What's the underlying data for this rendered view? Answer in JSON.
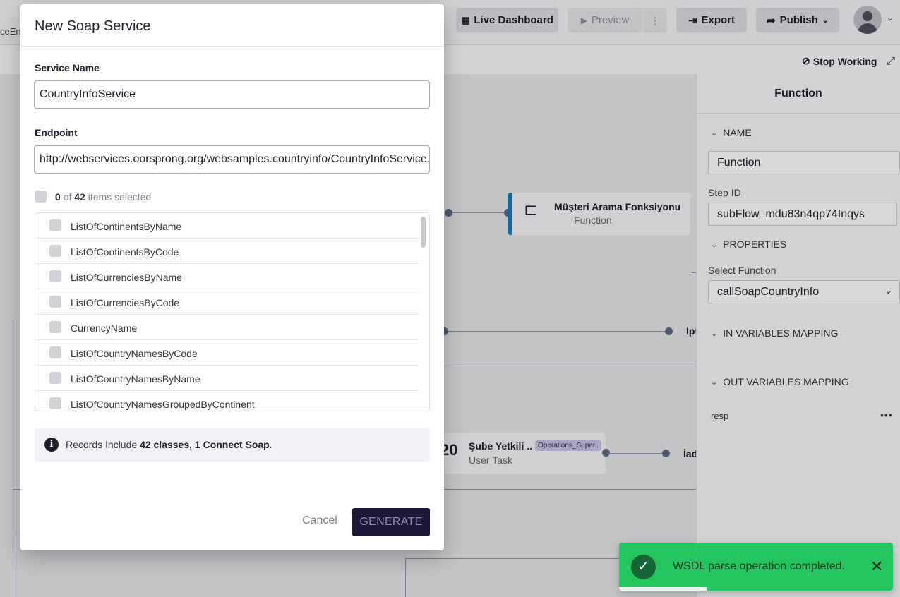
{
  "topbar": {
    "crumb": "ceEn..",
    "live_dashboard": "Live Dashboard",
    "preview": "Preview",
    "export": "Export",
    "publish": "Publish",
    "stop_working": "Stop Working"
  },
  "canvas": {
    "node1": {
      "title": "Müşteri Arama Fonksiyonu",
      "subtitle": "Function"
    },
    "node2": {
      "title": "Şube Yetkili ..",
      "subtitle": "User Task",
      "tag": "Operations_Super.."
    },
    "partial1": "Ipt",
    "partial2": "İad"
  },
  "panel": {
    "title": "Function",
    "name_section": "NAME",
    "name_value": "Function",
    "step_id_label": "Step ID",
    "step_id_value": "subFlow_mdu83n4qp74Inqys",
    "properties_section": "PROPERTIES",
    "select_function_label": "Select Function",
    "select_function_value": "callSoapCountryInfo",
    "in_mapping": "IN VARIABLES MAPPING",
    "out_mapping": "OUT VARIABLES MAPPING",
    "resp": "resp"
  },
  "modal": {
    "title": "New Soap Service",
    "service_name_label": "Service Name",
    "service_name_value": "CountryInfoService",
    "endpoint_label": "Endpoint",
    "endpoint_value": "http://webservices.oorsprong.org/websamples.countryinfo/CountryInfoService.wso",
    "selected_count": "0",
    "selected_of": "of",
    "total_count": "42",
    "selected_suffix": "items selected",
    "items": [
      "ListOfContinentsByName",
      "ListOfContinentsByCode",
      "ListOfCurrenciesByName",
      "ListOfCurrenciesByCode",
      "CurrencyName",
      "ListOfCountryNamesByCode",
      "ListOfCountryNamesByName",
      "ListOfCountryNamesGroupedByContinent"
    ],
    "info_prefix": "Records Include",
    "info_bold": "42 classes, 1 Connect Soap",
    "info_suffix": ".",
    "cancel": "Cancel",
    "generate": "GENERATE"
  },
  "toast": {
    "message": "WSDL parse operation completed.",
    "progress": 0.32
  }
}
